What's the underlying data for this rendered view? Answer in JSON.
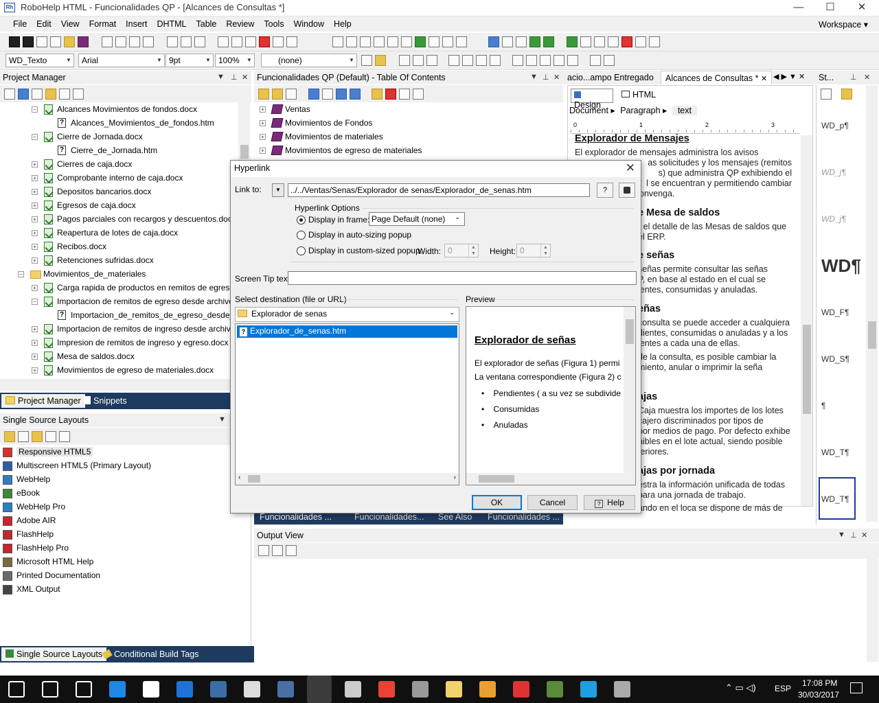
{
  "app": {
    "title": "RoboHelp HTML - Funcionalidades QP - [Alcances de Consultas *]",
    "icon_text": "Rh",
    "window_controls": [
      "—",
      "☐",
      "✕"
    ]
  },
  "menu": {
    "items": [
      "File",
      "Edit",
      "View",
      "Format",
      "Insert",
      "DHTML",
      "Table",
      "Review",
      "Tools",
      "Window",
      "Help"
    ],
    "workspace": "Workspace ▾"
  },
  "format_bar": {
    "style": "WD_Texto",
    "font": "Arial",
    "size": "9pt",
    "zoom": "100%",
    "list_style": "(none)"
  },
  "project_manager": {
    "title": "Project Manager",
    "items": [
      {
        "label": "Alcances Movimientos de fondos.docx",
        "type": "docx",
        "indent": 2,
        "expander": "−"
      },
      {
        "label": "Alcances_Movimientos_de_fondos.htm",
        "type": "htm",
        "indent": 3,
        "expander": ""
      },
      {
        "label": "Cierre de Jornada.docx",
        "type": "docx",
        "indent": 2,
        "expander": "−"
      },
      {
        "label": "Cierre_de_Jornada.htm",
        "type": "htm",
        "indent": 3,
        "expander": ""
      },
      {
        "label": "Cierres de caja.docx",
        "type": "docx",
        "indent": 2,
        "expander": "+"
      },
      {
        "label": "Comprobante interno de caja.docx",
        "type": "docx",
        "indent": 2,
        "expander": "+"
      },
      {
        "label": "Depositos bancarios.docx",
        "type": "docx",
        "indent": 2,
        "expander": "+"
      },
      {
        "label": "Egresos de caja.docx",
        "type": "docx",
        "indent": 2,
        "expander": "+"
      },
      {
        "label": "Pagos parciales con recargos y descuentos.docx",
        "type": "docx",
        "indent": 2,
        "expander": "+"
      },
      {
        "label": "Reapertura de lotes de caja.docx",
        "type": "docx",
        "indent": 2,
        "expander": "+"
      },
      {
        "label": "Recibos.docx",
        "type": "docx",
        "indent": 2,
        "expander": "+"
      },
      {
        "label": "Retenciones sufridas.docx",
        "type": "docx",
        "indent": 2,
        "expander": "+"
      },
      {
        "label": "Movimientos_de_materiales",
        "type": "folder",
        "indent": 1,
        "expander": "−"
      },
      {
        "label": "Carga rapida de productos en remitos de egreso.docx",
        "type": "docx",
        "indent": 2,
        "expander": "+"
      },
      {
        "label": "Importacion de remitos de egreso desde archivos .docx",
        "type": "docx",
        "indent": 2,
        "expander": "−"
      },
      {
        "label": "Importacion_de_remitos_de_egreso_desde_archivos.htm",
        "type": "htm",
        "indent": 3,
        "expander": ""
      },
      {
        "label": "Importacion de remitos de ingreso desde archivos.docx",
        "type": "docx",
        "indent": 2,
        "expander": "+"
      },
      {
        "label": "Impresion de remitos de ingreso y egreso.docx",
        "type": "docx",
        "indent": 2,
        "expander": "+"
      },
      {
        "label": "Mesa de saldos.docx",
        "type": "docx",
        "indent": 2,
        "expander": "+"
      },
      {
        "label": "Movimientos de egreso de materiales.docx",
        "type": "docx",
        "indent": 2,
        "expander": "+"
      }
    ],
    "tabs": [
      "Project Manager",
      "Snippets"
    ]
  },
  "single_source": {
    "title": "Single Source Layouts",
    "items": [
      {
        "label": "Responsive HTML5",
        "color": "#d9302c"
      },
      {
        "label": "Multiscreen HTML5 (Primary Layout)",
        "color": "#2d5fa8"
      },
      {
        "label": "WebHelp",
        "color": "#2f7fc1"
      },
      {
        "label": "eBook",
        "color": "#3a8a3a"
      },
      {
        "label": "WebHelp Pro",
        "color": "#2f7fc1"
      },
      {
        "label": "Adobe AIR",
        "color": "#c0282d"
      },
      {
        "label": "FlashHelp",
        "color": "#c0282d"
      },
      {
        "label": "FlashHelp Pro",
        "color": "#c0282d"
      },
      {
        "label": "Microsoft HTML Help",
        "color": "#7a6a3a"
      },
      {
        "label": "Printed Documentation",
        "color": "#6a6a6a"
      },
      {
        "label": "XML Output",
        "color": "#444444"
      }
    ],
    "tabs": [
      "Single Source Layouts",
      "Conditional Build Tags"
    ]
  },
  "toc": {
    "title": "Funcionalidades QP (Default) - Table Of Contents",
    "items": [
      "Ventas",
      "Movimientos de Fondos",
      "Movimientos de materiales",
      "Movimientos de egreso de materiales"
    ],
    "bottom_tabs": [
      "Funcionalidades ...",
      "Funcionalidades...",
      "See Also",
      "Funcionalidades ..."
    ]
  },
  "editor": {
    "tabs": [
      "acio...ampo Entregado",
      "Alcances de Consultas *"
    ],
    "mode_tabs": [
      "Design",
      "HTML"
    ],
    "breadcrumb": [
      "Document ▸",
      "Paragraph ▸",
      "text"
    ],
    "ruler": [
      "0",
      "1",
      "2",
      "3"
    ],
    "heading1": "Explorador de Mensajes",
    "para1": [
      "El explorador de mensajes administra los avisos",
      "as solicitudes y los mensajes (remitos",
      "s) que administra QP exhibiendo el",
      "l se encuentran y permitiendo cambiar",
      "onvenga."
    ],
    "heading2": "e Mesa de saldos",
    "para2": [
      "r el detalle de las Mesas de saldos que",
      "el ERP."
    ],
    "heading3": "e señas",
    "para3": [
      "señas permite consultar las señas",
      "P, en base al estado en el cual se",
      "ientes, consumidas y anuladas."
    ],
    "heading4": "eñas",
    "para4": [
      "consulta se puede acceder a cualquiera",
      "dientes, consumidas o anuladas y a los",
      "ientes a cada una de ellas."
    ],
    "para5": [
      "de la consulta, es posible cambiar la",
      "miento, anular o imprimir la seña"
    ],
    "heading5": "ajas",
    "para6": [
      "Caja muestra los importes de los lotes",
      "cajero discriminados por tipos de",
      "por medios de pago. Por defecto exhibe",
      "nibles en el lote actual, siendo posible",
      "teriores."
    ],
    "heading6": "ajas por jornada",
    "para7": [
      "estra la información unificada de todas",
      "para una jornada de trabajo."
    ],
    "para8": "ando en el loca se dispone de más de"
  },
  "styles_pane": {
    "title": "St...",
    "items": [
      "WD_p¶",
      "WD_j¶",
      "WD_j¶",
      "WD¶",
      "WD_F¶",
      "WD_S¶",
      "¶",
      "WD_T¶",
      "WD_T¶"
    ]
  },
  "output_view": {
    "title": "Output View"
  },
  "dialog": {
    "title": "Hyperlink",
    "link_to_label": "Link to:",
    "link_to_value": "../../Ventas/Senas/Explorador de senas/Explorador_de_senas.htm",
    "options_label": "Hyperlink Options",
    "opt_frame": "Display in frame:",
    "frame_value": "Page Default (none)",
    "opt_auto": "Display in auto-sizing popup",
    "opt_custom": "Display in custom-sized popup:",
    "width_label": "Width:",
    "width_value": "0",
    "height_label": "Height:",
    "height_value": "0",
    "screentip_label": "Screen Tip text:",
    "screentip_value": "",
    "dest_label": "Select destination (file or URL)",
    "dest_folder": "Explorador de senas",
    "dest_file": "Explorador_de_senas.htm",
    "preview_label": "Preview",
    "preview_title": "Explorador de señas",
    "preview_p1": "El explorador de señas (Figura 1) permi",
    "preview_p2": "La ventana correspondiente (Figura 2) c",
    "preview_bullets": [
      "Pendientes ( a su vez se subdivide",
      "Consumidas",
      "Anuladas"
    ],
    "ok": "OK",
    "cancel": "Cancel",
    "help": "Help"
  },
  "taskbar": {
    "time": "17:08 PM",
    "date": "30/03/2017",
    "lang": "ESP",
    "icons": [
      "start-icon",
      "search-icon",
      "task-view-icon",
      "edge-icon",
      "store-icon",
      "defender-icon",
      "terminal-icon",
      "calculator-icon",
      "remote-icon",
      "robohelp-icon",
      "paint-icon",
      "chrome-icon",
      "tools-icon",
      "explorer-icon",
      "outlook-icon",
      "presenter-icon",
      "cash-icon",
      "skype-icon",
      "camera-icon"
    ]
  }
}
